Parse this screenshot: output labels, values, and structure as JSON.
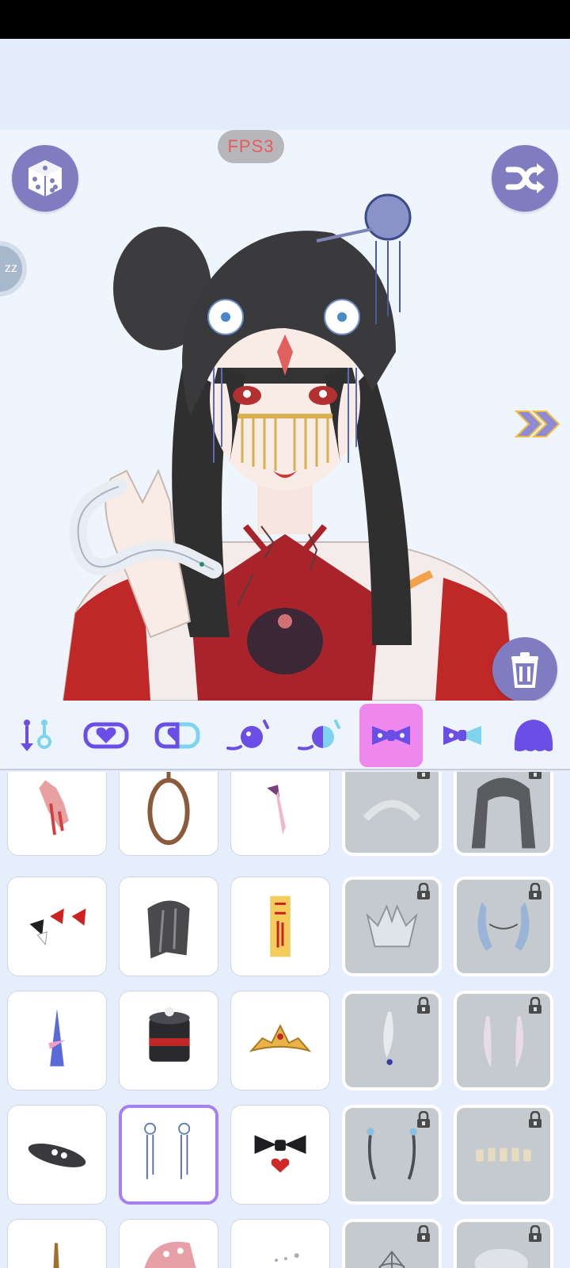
{
  "hud": {
    "fps_label": "FPS3",
    "side_badge_text": "zz"
  },
  "colors": {
    "accent": "#7f7cc2",
    "active_tab": "#ee88ee",
    "tab_icon": "#6b4ee6",
    "selected_border": "#a680f0"
  },
  "buttons": {
    "randomize": {
      "icon": "dice-icon"
    },
    "shuffle": {
      "icon": "shuffle-icon"
    },
    "delete": {
      "icon": "trash-icon"
    },
    "next": {
      "icon": "double-chevron-right-icon"
    }
  },
  "tabs": [
    {
      "icon": "earring-pair-icon",
      "active": false
    },
    {
      "icon": "heart-badge-icon",
      "active": false
    },
    {
      "icon": "heart-half-badge-icon",
      "active": false
    },
    {
      "icon": "ball-swoosh-icon",
      "active": false
    },
    {
      "icon": "half-ball-swoosh-icon",
      "active": false
    },
    {
      "icon": "bow-icon",
      "active": true
    },
    {
      "icon": "bow-half-icon",
      "active": false
    },
    {
      "icon": "blob-icon",
      "active": false
    }
  ],
  "items": [
    {
      "icon": "bloody-hand-icon",
      "locked": false,
      "selected": false
    },
    {
      "icon": "rope-noose-icon",
      "locked": false,
      "selected": false
    },
    {
      "icon": "butterfly-ribbon-icon",
      "locked": false,
      "selected": false
    },
    {
      "icon": "lace-headband-icon",
      "locked": true,
      "selected": false
    },
    {
      "icon": "hood-icon",
      "locked": true,
      "selected": false
    },
    {
      "icon": "red-bow-clip-icon",
      "locked": false,
      "selected": false
    },
    {
      "icon": "hair-bangs-icon",
      "locked": false,
      "selected": false
    },
    {
      "icon": "talisman-paper-icon",
      "locked": false,
      "selected": false
    },
    {
      "icon": "silver-crown-icon",
      "locked": true,
      "selected": false
    },
    {
      "icon": "horn-chain-icon",
      "locked": true,
      "selected": false
    },
    {
      "icon": "unicorn-horn-icon",
      "locked": false,
      "selected": false
    },
    {
      "icon": "top-hat-icon",
      "locked": false,
      "selected": false
    },
    {
      "icon": "gold-tiara-icon",
      "locked": false,
      "selected": false
    },
    {
      "icon": "feather-pin-icon",
      "locked": true,
      "selected": false
    },
    {
      "icon": "feather-wings-icon",
      "locked": true,
      "selected": false
    },
    {
      "icon": "flower-hat-icon",
      "locked": false,
      "selected": false
    },
    {
      "icon": "flower-tassel-pins-icon",
      "locked": false,
      "selected": true
    },
    {
      "icon": "black-bow-heart-icon",
      "locked": false,
      "selected": false
    },
    {
      "icon": "antenna-icon",
      "locked": true,
      "selected": false
    },
    {
      "icon": "tiny-teeth-icon",
      "locked": true,
      "selected": false
    },
    {
      "icon": "quill-icon",
      "locked": false,
      "selected": false
    },
    {
      "icon": "pink-cap-icon",
      "locked": false,
      "selected": false
    },
    {
      "icon": "dots-icon",
      "locked": false,
      "selected": false
    },
    {
      "icon": "spiderweb-icon",
      "locked": true,
      "selected": false
    },
    {
      "icon": "beret-icon",
      "locked": true,
      "selected": false
    }
  ]
}
